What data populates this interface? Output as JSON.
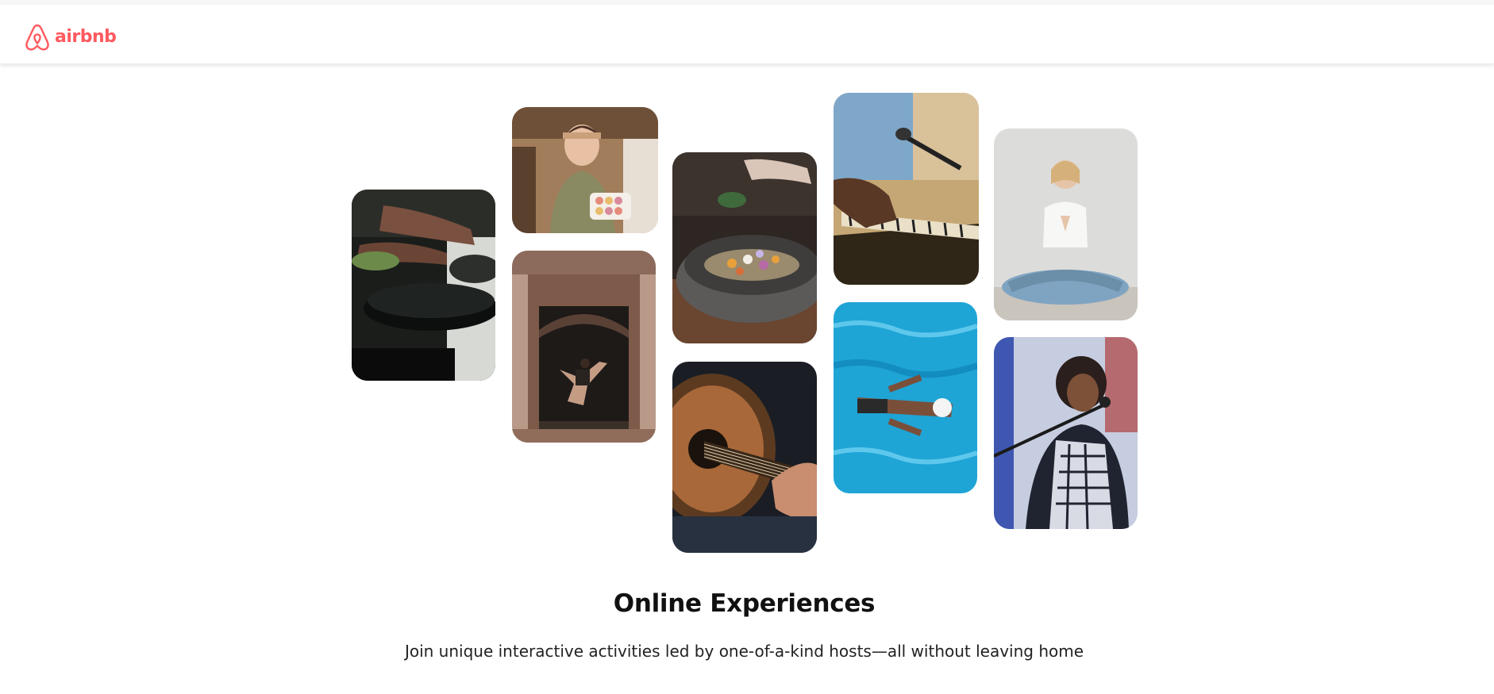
{
  "brand": {
    "name": "airbnb",
    "accent_color": "#FF5A5F"
  },
  "hero": {
    "title": "Online Experiences",
    "subtitle": "Join unique interactive activities led by one-of-a-kind hosts—all without leaving home"
  },
  "photos": [
    {
      "subject": "cooking-pan",
      "icon": "cooking-photo"
    },
    {
      "subject": "baker-macarons",
      "icon": "baker-photo"
    },
    {
      "subject": "dancer-doorway",
      "icon": "dancer-photo"
    },
    {
      "subject": "food-bowl",
      "icon": "food-bowl-photo"
    },
    {
      "subject": "guitar",
      "icon": "guitar-photo"
    },
    {
      "subject": "piano-microphone",
      "icon": "piano-photo"
    },
    {
      "subject": "swimmer",
      "icon": "swimmer-photo"
    },
    {
      "subject": "yoga",
      "icon": "yoga-photo"
    },
    {
      "subject": "singer",
      "icon": "singer-photo"
    }
  ]
}
